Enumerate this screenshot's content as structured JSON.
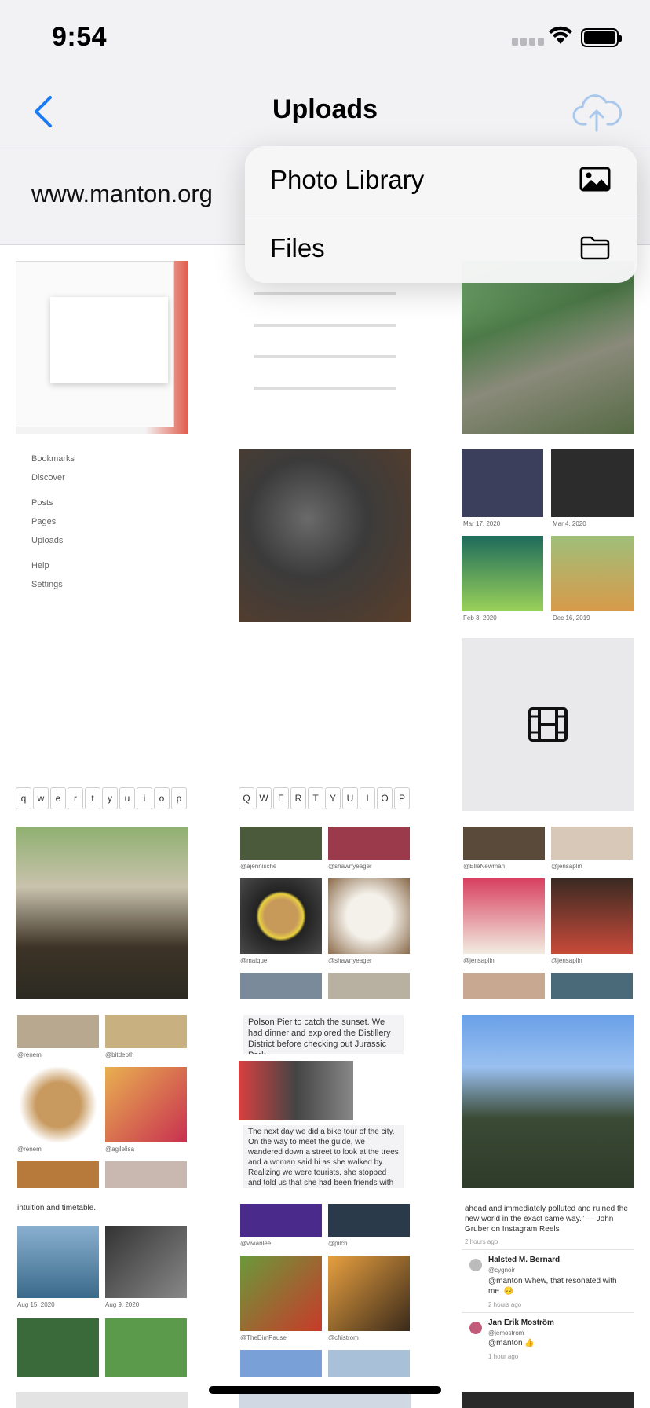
{
  "status_bar": {
    "time": "9:54"
  },
  "nav": {
    "title": "Uploads"
  },
  "url_bar": {
    "url": "www.manton.org"
  },
  "menu": {
    "items": [
      {
        "label": "Photo Library",
        "icon": "photo-icon"
      },
      {
        "label": "Files",
        "icon": "folder-icon"
      }
    ]
  },
  "grid": {
    "sidebar_items": [
      "Bookmarks",
      "Discover",
      "Posts",
      "Pages",
      "Uploads",
      "Help",
      "Settings"
    ],
    "keyboard_lower": [
      "q",
      "w",
      "e",
      "r",
      "t",
      "y",
      "u",
      "i",
      "o",
      "p"
    ],
    "keyboard_upper": [
      "Q",
      "W",
      "E",
      "R",
      "T",
      "Y",
      "U",
      "I",
      "O",
      "P"
    ],
    "art_dates": [
      "Mar 17, 2020",
      "Mar 4, 2020",
      "Feb 3, 2020",
      "Dec 16, 2019"
    ],
    "handles_mid": [
      "@ajennische",
      "@shawnyeager",
      "@maique",
      "@shawnyeager"
    ],
    "handles_right": [
      "@ElleNewman",
      "@jensaplin",
      "@jensaplin",
      "@jensaplin"
    ],
    "handles_left": [
      "@renem",
      "@bitdepth",
      "@renem",
      "@agilelisa"
    ],
    "handles_bottom_mid": [
      "@vivianlee",
      "@pilch",
      "@TheDimPause",
      "@cfristrom"
    ],
    "left_dates": [
      "Aug 15, 2020",
      "Aug 9, 2020"
    ],
    "text_snippet_1": "Polson Pier to catch the sunset. We had dinner and explored the Distillery District before checking out Jurassic Park.",
    "text_snippet_2": "The next day we did a bike tour of the city. On the way to meet the guide, we wandered down a street to look at the trees and a woman said hi as she walked by. Realizing we were tourists, she stopped and told us that she had been friends with Jane Jacobs, who lived just a block away.",
    "text_snippet_3": "intuition and timetable.",
    "quote_text": "ahead and immediately polluted and ruined the new world in the exact same way.” — John Gruber on Instagram Reels",
    "quote_time": "2 hours ago",
    "reply1_name": "Halsted M. Bernard",
    "reply1_handle": "@cygnoir",
    "reply1_text": "@manton Whew, that resonated with me. 😔",
    "reply1_time": "2 hours ago",
    "reply2_name": "Jan Erik Moström",
    "reply2_handle": "@jemostrom",
    "reply2_text": "@manton 👍",
    "reply2_time": "1 hour ago"
  }
}
